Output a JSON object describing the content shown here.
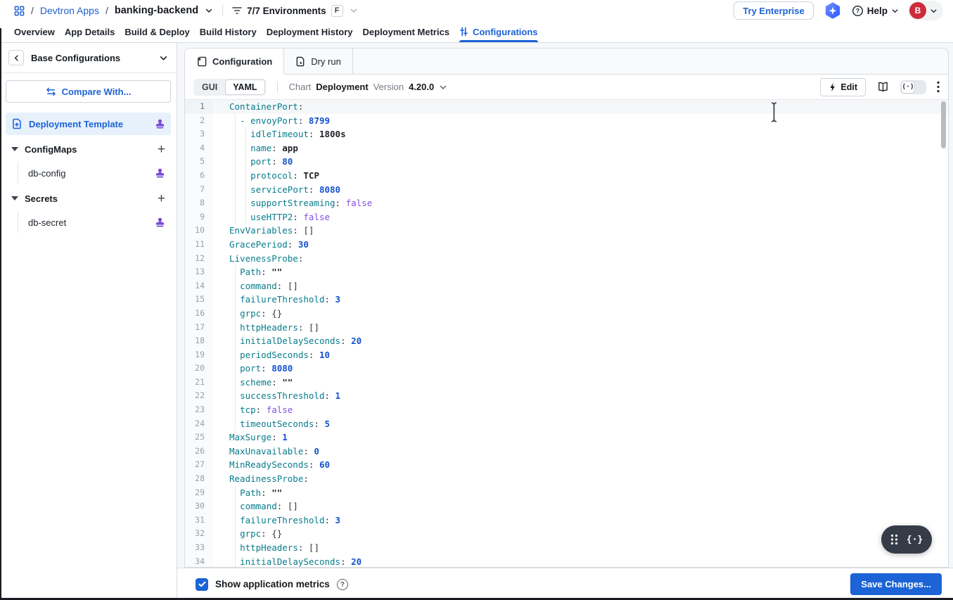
{
  "colors": {
    "accent": "#1C63D6",
    "link": "#2161CB",
    "code_key": "#077C8C",
    "code_number": "#1353CE",
    "code_bool": "#8250DF",
    "code_string": "#1F2328",
    "stamp_purple": "#7C4DD8",
    "avatar_red": "#CE2C3B",
    "selected_item_bg": "#E7F1FC",
    "save_button": "#1C63D6",
    "widget_bg": "#353C47"
  },
  "header": {
    "breadcrumb": {
      "separator": "/",
      "root": "Devtron Apps",
      "app": "banking-backend"
    },
    "environments": {
      "label": "7/7 Environments",
      "shortcut_badge": "F"
    },
    "try_enterprise_label": "Try Enterprise",
    "help_label": "Help",
    "avatar_initial": "B"
  },
  "nav": {
    "tabs": [
      {
        "label": "Overview"
      },
      {
        "label": "App Details"
      },
      {
        "label": "Build & Deploy"
      },
      {
        "label": "Build History"
      },
      {
        "label": "Deployment History"
      },
      {
        "label": "Deployment Metrics"
      },
      {
        "label": "Configurations",
        "active": true,
        "icon": "sliders"
      }
    ]
  },
  "sidebar": {
    "title": "Base Configurations",
    "compare_button_label": "Compare With...",
    "items": [
      {
        "type": "template",
        "label": "Deployment Template",
        "selected": true,
        "stamp": true
      },
      {
        "type": "group",
        "label": "ConfigMaps"
      },
      {
        "type": "child",
        "label": "db-config",
        "stamp": true
      },
      {
        "type": "group",
        "label": "Secrets"
      },
      {
        "type": "child",
        "label": "db-secret",
        "stamp": true
      }
    ]
  },
  "main": {
    "tabs": [
      {
        "label": "Configuration",
        "active": true,
        "icon": "config"
      },
      {
        "label": "Dry run",
        "icon": "dryrun"
      }
    ],
    "toolbar": {
      "modes": [
        {
          "label": "GUI"
        },
        {
          "label": "YAML",
          "selected": true
        }
      ],
      "chart_label": "Chart",
      "chart_name": "Deployment",
      "version_label": "Version",
      "version": "4.20.0",
      "edit_label": "Edit"
    },
    "footer": {
      "checkbox_label": "Show application metrics",
      "checked": true,
      "save_label": "Save Changes..."
    }
  },
  "editor": {
    "active_line": 1,
    "lines": [
      {
        "t": [
          [
            "k",
            "ContainerPort"
          ],
          [
            "p",
            ":"
          ]
        ]
      },
      {
        "g": [
          1
        ],
        "t": [
          [
            "w",
            "  "
          ],
          [
            "d",
            "- "
          ],
          [
            "k",
            "envoyPort"
          ],
          [
            "p",
            ": "
          ],
          [
            "n",
            "8799"
          ]
        ]
      },
      {
        "g": [
          1,
          3
        ],
        "t": [
          [
            "w",
            "    "
          ],
          [
            "k",
            "idleTimeout"
          ],
          [
            "p",
            ": "
          ],
          [
            "s",
            "1800s"
          ]
        ]
      },
      {
        "g": [
          1,
          3
        ],
        "t": [
          [
            "w",
            "    "
          ],
          [
            "k",
            "name"
          ],
          [
            "p",
            ": "
          ],
          [
            "s",
            "app"
          ]
        ]
      },
      {
        "g": [
          1,
          3
        ],
        "t": [
          [
            "w",
            "    "
          ],
          [
            "k",
            "port"
          ],
          [
            "p",
            ": "
          ],
          [
            "n",
            "80"
          ]
        ]
      },
      {
        "g": [
          1,
          3
        ],
        "t": [
          [
            "w",
            "    "
          ],
          [
            "k",
            "protocol"
          ],
          [
            "p",
            ": "
          ],
          [
            "s",
            "TCP"
          ]
        ]
      },
      {
        "g": [
          1,
          3
        ],
        "t": [
          [
            "w",
            "    "
          ],
          [
            "k",
            "servicePort"
          ],
          [
            "p",
            ": "
          ],
          [
            "n",
            "8080"
          ]
        ]
      },
      {
        "g": [
          1,
          3
        ],
        "t": [
          [
            "w",
            "    "
          ],
          [
            "k",
            "supportStreaming"
          ],
          [
            "p",
            ": "
          ],
          [
            "b",
            "false"
          ]
        ]
      },
      {
        "g": [
          1,
          3
        ],
        "t": [
          [
            "w",
            "    "
          ],
          [
            "k",
            "useHTTP2"
          ],
          [
            "p",
            ": "
          ],
          [
            "b",
            "false"
          ]
        ]
      },
      {
        "t": [
          [
            "k",
            "EnvVariables"
          ],
          [
            "p",
            ": "
          ],
          [
            "br",
            "[]"
          ]
        ]
      },
      {
        "t": [
          [
            "k",
            "GracePeriod"
          ],
          [
            "p",
            ": "
          ],
          [
            "n",
            "30"
          ]
        ]
      },
      {
        "t": [
          [
            "k",
            "LivenessProbe"
          ],
          [
            "p",
            ":"
          ]
        ]
      },
      {
        "g": [
          1
        ],
        "t": [
          [
            "w",
            "  "
          ],
          [
            "k",
            "Path"
          ],
          [
            "p",
            ": "
          ],
          [
            "s",
            "\"\""
          ]
        ]
      },
      {
        "g": [
          1
        ],
        "t": [
          [
            "w",
            "  "
          ],
          [
            "k",
            "command"
          ],
          [
            "p",
            ": "
          ],
          [
            "br",
            "[]"
          ]
        ]
      },
      {
        "g": [
          1
        ],
        "t": [
          [
            "w",
            "  "
          ],
          [
            "k",
            "failureThreshold"
          ],
          [
            "p",
            ": "
          ],
          [
            "n",
            "3"
          ]
        ]
      },
      {
        "g": [
          1
        ],
        "t": [
          [
            "w",
            "  "
          ],
          [
            "k",
            "grpc"
          ],
          [
            "p",
            ": "
          ],
          [
            "br",
            "{}"
          ]
        ]
      },
      {
        "g": [
          1
        ],
        "t": [
          [
            "w",
            "  "
          ],
          [
            "k",
            "httpHeaders"
          ],
          [
            "p",
            ": "
          ],
          [
            "br",
            "[]"
          ]
        ]
      },
      {
        "g": [
          1
        ],
        "t": [
          [
            "w",
            "  "
          ],
          [
            "k",
            "initialDelaySeconds"
          ],
          [
            "p",
            ": "
          ],
          [
            "n",
            "20"
          ]
        ]
      },
      {
        "g": [
          1
        ],
        "t": [
          [
            "w",
            "  "
          ],
          [
            "k",
            "periodSeconds"
          ],
          [
            "p",
            ": "
          ],
          [
            "n",
            "10"
          ]
        ]
      },
      {
        "g": [
          1
        ],
        "t": [
          [
            "w",
            "  "
          ],
          [
            "k",
            "port"
          ],
          [
            "p",
            ": "
          ],
          [
            "n",
            "8080"
          ]
        ]
      },
      {
        "g": [
          1
        ],
        "t": [
          [
            "w",
            "  "
          ],
          [
            "k",
            "scheme"
          ],
          [
            "p",
            ": "
          ],
          [
            "s",
            "\"\""
          ]
        ]
      },
      {
        "g": [
          1
        ],
        "t": [
          [
            "w",
            "  "
          ],
          [
            "k",
            "successThreshold"
          ],
          [
            "p",
            ": "
          ],
          [
            "n",
            "1"
          ]
        ]
      },
      {
        "g": [
          1
        ],
        "t": [
          [
            "w",
            "  "
          ],
          [
            "k",
            "tcp"
          ],
          [
            "p",
            ": "
          ],
          [
            "b",
            "false"
          ]
        ]
      },
      {
        "g": [
          1
        ],
        "t": [
          [
            "w",
            "  "
          ],
          [
            "k",
            "timeoutSeconds"
          ],
          [
            "p",
            ": "
          ],
          [
            "n",
            "5"
          ]
        ]
      },
      {
        "t": [
          [
            "k",
            "MaxSurge"
          ],
          [
            "p",
            ": "
          ],
          [
            "n",
            "1"
          ]
        ]
      },
      {
        "t": [
          [
            "k",
            "MaxUnavailable"
          ],
          [
            "p",
            ": "
          ],
          [
            "n",
            "0"
          ]
        ]
      },
      {
        "t": [
          [
            "k",
            "MinReadySeconds"
          ],
          [
            "p",
            ": "
          ],
          [
            "n",
            "60"
          ]
        ]
      },
      {
        "t": [
          [
            "k",
            "ReadinessProbe"
          ],
          [
            "p",
            ":"
          ]
        ]
      },
      {
        "g": [
          1
        ],
        "t": [
          [
            "w",
            "  "
          ],
          [
            "k",
            "Path"
          ],
          [
            "p",
            ": "
          ],
          [
            "s",
            "\"\""
          ]
        ]
      },
      {
        "g": [
          1
        ],
        "t": [
          [
            "w",
            "  "
          ],
          [
            "k",
            "command"
          ],
          [
            "p",
            ": "
          ],
          [
            "br",
            "[]"
          ]
        ]
      },
      {
        "g": [
          1
        ],
        "t": [
          [
            "w",
            "  "
          ],
          [
            "k",
            "failureThreshold"
          ],
          [
            "p",
            ": "
          ],
          [
            "n",
            "3"
          ]
        ]
      },
      {
        "g": [
          1
        ],
        "t": [
          [
            "w",
            "  "
          ],
          [
            "k",
            "grpc"
          ],
          [
            "p",
            ": "
          ],
          [
            "br",
            "{}"
          ]
        ]
      },
      {
        "g": [
          1
        ],
        "t": [
          [
            "w",
            "  "
          ],
          [
            "k",
            "httpHeaders"
          ],
          [
            "p",
            ": "
          ],
          [
            "br",
            "[]"
          ]
        ]
      },
      {
        "g": [
          1
        ],
        "t": [
          [
            "w",
            "  "
          ],
          [
            "k",
            "initialDelaySeconds"
          ],
          [
            "p",
            ": "
          ],
          [
            "n",
            "20"
          ]
        ]
      }
    ]
  }
}
